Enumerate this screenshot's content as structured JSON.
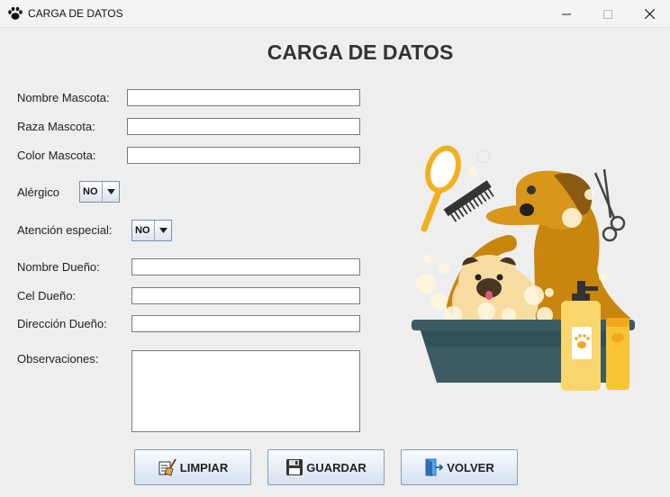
{
  "window": {
    "title": "CARGA DE DATOS",
    "icon": "paw-icon",
    "controls": [
      "minimize-icon",
      "maximize-icon",
      "close-icon"
    ]
  },
  "heading": "CARGA DE DATOS",
  "form": {
    "nombre_mascota": {
      "label": "Nombre Mascota:",
      "value": ""
    },
    "raza_mascota": {
      "label": "Raza Mascota:",
      "value": ""
    },
    "color_mascota": {
      "label": "Color Mascota:",
      "value": ""
    },
    "alergico": {
      "label": "Alérgico",
      "value": "NO"
    },
    "atencion_especial": {
      "label": "Atención especial:",
      "value": "NO"
    },
    "nombre_dueno": {
      "label": "Nombre Dueño:",
      "value": ""
    },
    "cel_dueno": {
      "label": "Cel Dueño:",
      "value": ""
    },
    "direccion_dueno": {
      "label": "Dirección Dueño:",
      "value": ""
    },
    "observaciones": {
      "label": "Observaciones:",
      "value": ""
    }
  },
  "buttons": {
    "limpiar": {
      "label": "LIMPIAR",
      "icon": "broom-icon"
    },
    "guardar": {
      "label": "GUARDAR",
      "icon": "floppy-disk-icon"
    },
    "volver": {
      "label": "VOLVER",
      "icon": "exit-door-icon"
    }
  },
  "illustration": "dog-bath-grooming-illustration",
  "colors": {
    "window_bg": "#eeeeee",
    "button_top": "#f8fbff",
    "button_bottom": "#d4e0ef",
    "dog_brown": "#c8860e",
    "tub": "#3e5a63"
  }
}
